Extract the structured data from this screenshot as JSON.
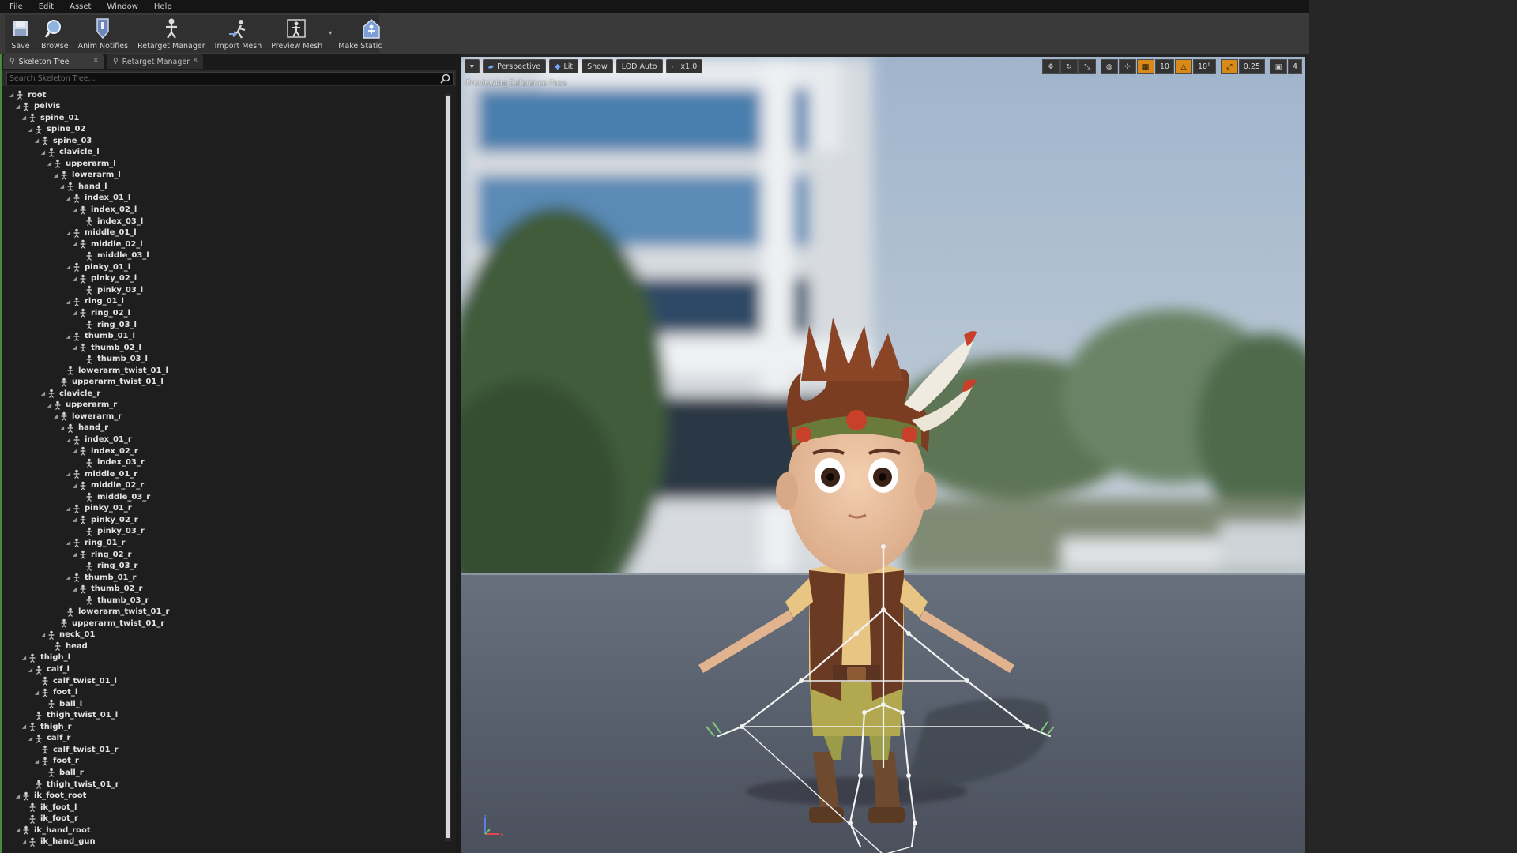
{
  "menu": [
    "File",
    "Edit",
    "Asset",
    "Window",
    "Help"
  ],
  "toolbar": {
    "items": [
      {
        "label": "Save",
        "icon": "save-icon"
      },
      {
        "label": "Browse",
        "icon": "browse-icon"
      },
      {
        "label": "Anim Notifies",
        "icon": "anim-notifies-icon"
      },
      {
        "label": "Retarget Manager",
        "icon": "retarget-manager-icon"
      },
      {
        "label": "Import Mesh",
        "icon": "import-mesh-icon"
      },
      {
        "label": "Preview Mesh",
        "icon": "preview-mesh-icon"
      },
      {
        "label": "Make Static Mesh",
        "icon": "make-static-mesh-icon"
      }
    ]
  },
  "tabs": [
    {
      "label": "Skeleton Tree",
      "active": true
    },
    {
      "label": "Retarget Manager",
      "active": false
    }
  ],
  "search": {
    "placeholder": "Search Skeleton Tree...",
    "value": ""
  },
  "skeleton_tree": [
    {
      "name": "root",
      "depth": 0,
      "expander": true
    },
    {
      "name": "pelvis",
      "depth": 1,
      "expander": true
    },
    {
      "name": "spine_01",
      "depth": 2,
      "expander": true
    },
    {
      "name": "spine_02",
      "depth": 3,
      "expander": true
    },
    {
      "name": "spine_03",
      "depth": 4,
      "expander": true
    },
    {
      "name": "clavicle_l",
      "depth": 5,
      "expander": true
    },
    {
      "name": "upperarm_l",
      "depth": 6,
      "expander": true
    },
    {
      "name": "lowerarm_l",
      "depth": 7,
      "expander": true
    },
    {
      "name": "hand_l",
      "depth": 8,
      "expander": true
    },
    {
      "name": "index_01_l",
      "depth": 9,
      "expander": true
    },
    {
      "name": "index_02_l",
      "depth": 10,
      "expander": true
    },
    {
      "name": "index_03_l",
      "depth": 11,
      "expander": false
    },
    {
      "name": "middle_01_l",
      "depth": 9,
      "expander": true
    },
    {
      "name": "middle_02_l",
      "depth": 10,
      "expander": true
    },
    {
      "name": "middle_03_l",
      "depth": 11,
      "expander": false
    },
    {
      "name": "pinky_01_l",
      "depth": 9,
      "expander": true
    },
    {
      "name": "pinky_02_l",
      "depth": 10,
      "expander": true
    },
    {
      "name": "pinky_03_l",
      "depth": 11,
      "expander": false
    },
    {
      "name": "ring_01_l",
      "depth": 9,
      "expander": true
    },
    {
      "name": "ring_02_l",
      "depth": 10,
      "expander": true
    },
    {
      "name": "ring_03_l",
      "depth": 11,
      "expander": false
    },
    {
      "name": "thumb_01_l",
      "depth": 9,
      "expander": true
    },
    {
      "name": "thumb_02_l",
      "depth": 10,
      "expander": true
    },
    {
      "name": "thumb_03_l",
      "depth": 11,
      "expander": false
    },
    {
      "name": "lowerarm_twist_01_l",
      "depth": 8,
      "expander": false
    },
    {
      "name": "upperarm_twist_01_l",
      "depth": 7,
      "expander": false
    },
    {
      "name": "clavicle_r",
      "depth": 5,
      "expander": true
    },
    {
      "name": "upperarm_r",
      "depth": 6,
      "expander": true
    },
    {
      "name": "lowerarm_r",
      "depth": 7,
      "expander": true
    },
    {
      "name": "hand_r",
      "depth": 8,
      "expander": true
    },
    {
      "name": "index_01_r",
      "depth": 9,
      "expander": true
    },
    {
      "name": "index_02_r",
      "depth": 10,
      "expander": true
    },
    {
      "name": "index_03_r",
      "depth": 11,
      "expander": false
    },
    {
      "name": "middle_01_r",
      "depth": 9,
      "expander": true
    },
    {
      "name": "middle_02_r",
      "depth": 10,
      "expander": true
    },
    {
      "name": "middle_03_r",
      "depth": 11,
      "expander": false
    },
    {
      "name": "pinky_01_r",
      "depth": 9,
      "expander": true
    },
    {
      "name": "pinky_02_r",
      "depth": 10,
      "expander": true
    },
    {
      "name": "pinky_03_r",
      "depth": 11,
      "expander": false
    },
    {
      "name": "ring_01_r",
      "depth": 9,
      "expander": true
    },
    {
      "name": "ring_02_r",
      "depth": 10,
      "expander": true
    },
    {
      "name": "ring_03_r",
      "depth": 11,
      "expander": false
    },
    {
      "name": "thumb_01_r",
      "depth": 9,
      "expander": true
    },
    {
      "name": "thumb_02_r",
      "depth": 10,
      "expander": true
    },
    {
      "name": "thumb_03_r",
      "depth": 11,
      "expander": false
    },
    {
      "name": "lowerarm_twist_01_r",
      "depth": 8,
      "expander": false
    },
    {
      "name": "upperarm_twist_01_r",
      "depth": 7,
      "expander": false
    },
    {
      "name": "neck_01",
      "depth": 5,
      "expander": true
    },
    {
      "name": "head",
      "depth": 6,
      "expander": false
    },
    {
      "name": "thigh_l",
      "depth": 2,
      "expander": true
    },
    {
      "name": "calf_l",
      "depth": 3,
      "expander": true
    },
    {
      "name": "calf_twist_01_l",
      "depth": 4,
      "expander": false
    },
    {
      "name": "foot_l",
      "depth": 4,
      "expander": true
    },
    {
      "name": "ball_l",
      "depth": 5,
      "expander": false
    },
    {
      "name": "thigh_twist_01_l",
      "depth": 3,
      "expander": false
    },
    {
      "name": "thigh_r",
      "depth": 2,
      "expander": true
    },
    {
      "name": "calf_r",
      "depth": 3,
      "expander": true
    },
    {
      "name": "calf_twist_01_r",
      "depth": 4,
      "expander": false
    },
    {
      "name": "foot_r",
      "depth": 4,
      "expander": true
    },
    {
      "name": "ball_r",
      "depth": 5,
      "expander": false
    },
    {
      "name": "thigh_twist_01_r",
      "depth": 3,
      "expander": false
    },
    {
      "name": "ik_foot_root",
      "depth": 1,
      "expander": true
    },
    {
      "name": "ik_foot_l",
      "depth": 2,
      "expander": false
    },
    {
      "name": "ik_foot_r",
      "depth": 2,
      "expander": false
    },
    {
      "name": "ik_hand_root",
      "depth": 1,
      "expander": true
    },
    {
      "name": "ik_hand_gun",
      "depth": 2,
      "expander": true
    }
  ],
  "viewport": {
    "buttons": {
      "perspective": "Perspective",
      "lit": "Lit",
      "show": "Show",
      "lod": "LOD Auto",
      "speed": "x1.0"
    },
    "right_values": {
      "grid_snap": "10",
      "rotation_snap": "10°",
      "scale_snap": "0.25",
      "camera_speed": "4"
    },
    "status_text": "Previewing Reference Pose",
    "colors": {
      "snap_active": "#d98a16",
      "sky": "#9fb4cc",
      "floor": "#565d6b"
    }
  }
}
